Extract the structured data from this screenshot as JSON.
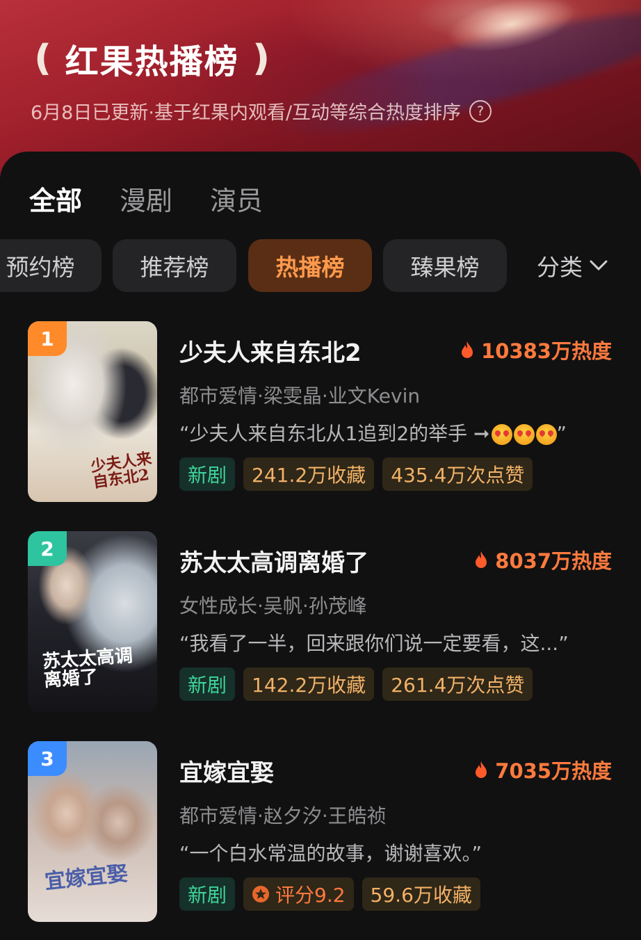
{
  "header": {
    "title": "红果热播榜",
    "subtitle": "6月8日已更新·基于红果内观看/互动等综合热度排序"
  },
  "main_tabs": [
    {
      "label": "全部",
      "active": true
    },
    {
      "label": "漫剧",
      "active": false
    },
    {
      "label": "演员",
      "active": false
    }
  ],
  "chips": [
    {
      "label": "预约榜",
      "active": false
    },
    {
      "label": "推荐榜",
      "active": false
    },
    {
      "label": "热播榜",
      "active": true
    },
    {
      "label": "臻果榜",
      "active": false
    }
  ],
  "category_label": "分类",
  "colors": {
    "accent": "#ff7a3d",
    "rank1": "#ff8a2a",
    "rank2": "#2ec4a0",
    "rank3": "#3b8cff",
    "new_badge": "#3fd49a"
  },
  "list": [
    {
      "rank": "1",
      "title": "少夫人来自东北2",
      "heat": "10383万热度",
      "tags": "都市爱情·梁雯晶·业文Kevin",
      "quote": "“少夫人来自东北从1追到2的举手 ➞",
      "quote_end": "”",
      "badges": [
        "新剧",
        "241.2万收藏",
        "435.4万次点赞"
      ],
      "poster_text": "少夫人来自东北2"
    },
    {
      "rank": "2",
      "title": "苏太太高调离婚了",
      "heat": "8037万热度",
      "tags": "女性成长·吴帆·孙茂峰",
      "quote": "“我看了一半，回来跟你们说一定要看，这...”",
      "badges": [
        "新剧",
        "142.2万收藏",
        "261.4万次点赞"
      ],
      "poster_text": "苏太太高调离婚了"
    },
    {
      "rank": "3",
      "title": "宜嫁宜娶",
      "heat": "7035万热度",
      "tags": "都市爱情·赵夕汐·王皓祯",
      "quote": "“一个白水常温的故事，谢谢喜欢。”",
      "badges": [
        "新剧",
        "评分9.2",
        "59.6万收藏"
      ],
      "poster_text": "宜嫁宜娶"
    }
  ]
}
